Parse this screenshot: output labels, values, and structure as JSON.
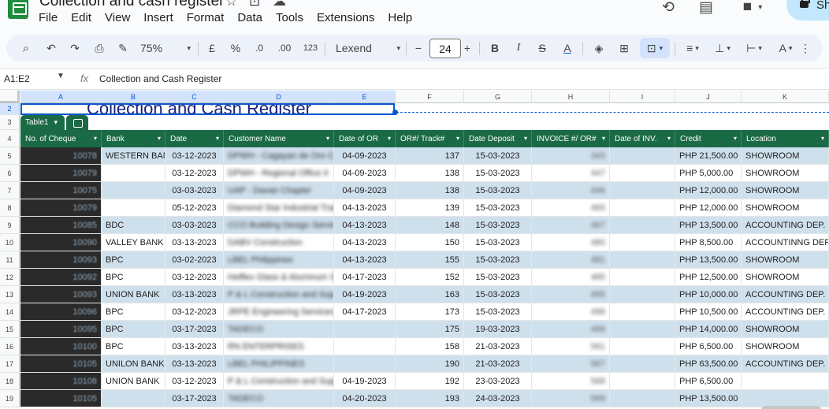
{
  "title": "Collection and cash register",
  "menu": [
    "File",
    "Edit",
    "View",
    "Insert",
    "Format",
    "Data",
    "Tools",
    "Extensions",
    "Help"
  ],
  "share_label": "Share",
  "toolbar": {
    "zoom": "75%",
    "currency": "£",
    "percent": "%",
    "dec_decrease": ".0",
    "dec_increase": ".00",
    "number_format": "123",
    "font": "Lexend",
    "font_size": "24"
  },
  "namebox": "A1:E2",
  "formula": "Collection and Cash Register",
  "columns": [
    "A",
    "B",
    "C",
    "D",
    "E",
    "F",
    "G",
    "H",
    "I",
    "J",
    "K"
  ],
  "row_numbers": [
    "2",
    "3",
    "4",
    "5",
    "6",
    "7",
    "8",
    "9",
    "10",
    "11",
    "12",
    "13",
    "14",
    "15",
    "16",
    "17",
    "18",
    "19"
  ],
  "merged_title": "Collection and Cash Register",
  "table_name": "Table1",
  "headers": [
    "No. of Cheque",
    "Bank",
    "Date",
    "Customer Name",
    "Date of OR",
    "OR#/ Track#",
    "Date Deposit",
    "INVOICE #/ OR#",
    "Date of INV.",
    "Credit",
    "Location"
  ],
  "rows": [
    {
      "cheque": "10078",
      "bank": "WESTERN BANK",
      "date": "03-12-2023",
      "customer": "DPWH - Cagayan de Oro City",
      "date_or": "04-09-2023",
      "or": "137",
      "deposit": "15-03-2023",
      "invoice": "343",
      "date_inv": "",
      "credit": "PHP 21,500.00",
      "location": "SHOWROOM"
    },
    {
      "cheque": "10079",
      "bank": "",
      "date": "03-12-2023",
      "customer": "DPWH - Regional Office II",
      "date_or": "04-09-2023",
      "or": "138",
      "deposit": "15-03-2023",
      "invoice": "447",
      "date_inv": "",
      "credit": "PHP 5,000.00",
      "location": "SHOWROOM"
    },
    {
      "cheque": "10075",
      "bank": "",
      "date": "03-03-2023",
      "customer": "UAP - Davao Chapter",
      "date_or": "04-09-2023",
      "or": "138",
      "deposit": "15-03-2023",
      "invoice": "446",
      "date_inv": "",
      "credit": "PHP 12,000.00",
      "location": "SHOWROOM"
    },
    {
      "cheque": "10079",
      "bank": "",
      "date": "05-12-2023",
      "customer": "Diamond Star Industrial Trading",
      "date_or": "04-13-2023",
      "or": "139",
      "deposit": "15-03-2023",
      "invoice": "465",
      "date_inv": "",
      "credit": "PHP 12,000.00",
      "location": "SHOWROOM"
    },
    {
      "cheque": "10085",
      "bank": "BDC",
      "date": "03-03-2023",
      "customer": "CCO Building Design Services",
      "date_or": "04-13-2023",
      "or": "148",
      "deposit": "15-03-2023",
      "invoice": "467",
      "date_inv": "",
      "credit": "PHP 13,500.00",
      "location": "ACCOUNTING DEP."
    },
    {
      "cheque": "10090",
      "bank": "VALLEY BANK",
      "date": "03-13-2023",
      "customer": "DABV Construction",
      "date_or": "04-13-2023",
      "or": "150",
      "deposit": "15-03-2023",
      "invoice": "480",
      "date_inv": "",
      "credit": "PHP 8,500.00",
      "location": "ACCOUNTINNG DEP."
    },
    {
      "cheque": "10093",
      "bank": "BPC",
      "date": "03-02-2023",
      "customer": "LBEL Philippines",
      "date_or": "04-13-2023",
      "or": "155",
      "deposit": "15-03-2023",
      "invoice": "481",
      "date_inv": "",
      "credit": "PHP 13,500.00",
      "location": "SHOWROOM"
    },
    {
      "cheque": "10092",
      "bank": "BPC",
      "date": "03-12-2023",
      "customer": "Helflex Glass & Aluminum Supply",
      "date_or": "04-17-2023",
      "or": "152",
      "deposit": "15-03-2023",
      "invoice": "485",
      "date_inv": "",
      "credit": "PHP 12,500.00",
      "location": "SHOWROOM"
    },
    {
      "cheque": "10093",
      "bank": "UNION BANK",
      "date": "03-13-2023",
      "customer": "P & L Construction and Supply",
      "date_or": "04-19-2023",
      "or": "163",
      "deposit": "15-03-2023",
      "invoice": "495",
      "date_inv": "",
      "credit": "PHP 10,000.00",
      "location": "ACCOUNTING DEP."
    },
    {
      "cheque": "10096",
      "bank": "BPC",
      "date": "03-12-2023",
      "customer": "JRPE Engineering Services",
      "date_or": "04-17-2023",
      "or": "173",
      "deposit": "15-03-2023",
      "invoice": "498",
      "date_inv": "",
      "credit": "PHP 10,500.00",
      "location": "ACCOUNTING DEP."
    },
    {
      "cheque": "10095",
      "bank": "BPC",
      "date": "03-17-2023",
      "customer": "TADECO",
      "date_or": "",
      "or": "175",
      "deposit": "19-03-2023",
      "invoice": "499",
      "date_inv": "",
      "credit": "PHP 14,000.00",
      "location": "SHOWROOM"
    },
    {
      "cheque": "10100",
      "bank": "BPC",
      "date": "03-13-2023",
      "customer": "RN ENTERPRISES",
      "date_or": "",
      "or": "158",
      "deposit": "21-03-2023",
      "invoice": "561",
      "date_inv": "",
      "credit": "PHP 6,500.00",
      "location": "SHOWROOM"
    },
    {
      "cheque": "10105",
      "bank": "UNILON BANK",
      "date": "03-13-2023",
      "customer": "LBEL PHILIPPINES",
      "date_or": "",
      "or": "190",
      "deposit": "21-03-2023",
      "invoice": "567",
      "date_inv": "",
      "credit": "PHP 63,500.00",
      "location": "ACCOUNTING DEP."
    },
    {
      "cheque": "10108",
      "bank": "UNION BANK",
      "date": "03-12-2023",
      "customer": "P & L Construction and Supply",
      "date_or": "04-19-2023",
      "or": "192",
      "deposit": "23-03-2023",
      "invoice": "568",
      "date_inv": "",
      "credit": "PHP 6,500.00",
      "location": ""
    },
    {
      "cheque": "10105",
      "bank": "",
      "date": "03-17-2023",
      "customer": "TADECO",
      "date_or": "04-20-2023",
      "or": "193",
      "deposit": "24-03-2023",
      "invoice": "569",
      "date_inv": "",
      "credit": "PHP 13,500.00",
      "location": ""
    }
  ],
  "colors": {
    "header_green": "#1a6a45",
    "band_blue": "#cfe0ed",
    "selection": "#0b57d0",
    "title_navy": "#1a237e"
  }
}
